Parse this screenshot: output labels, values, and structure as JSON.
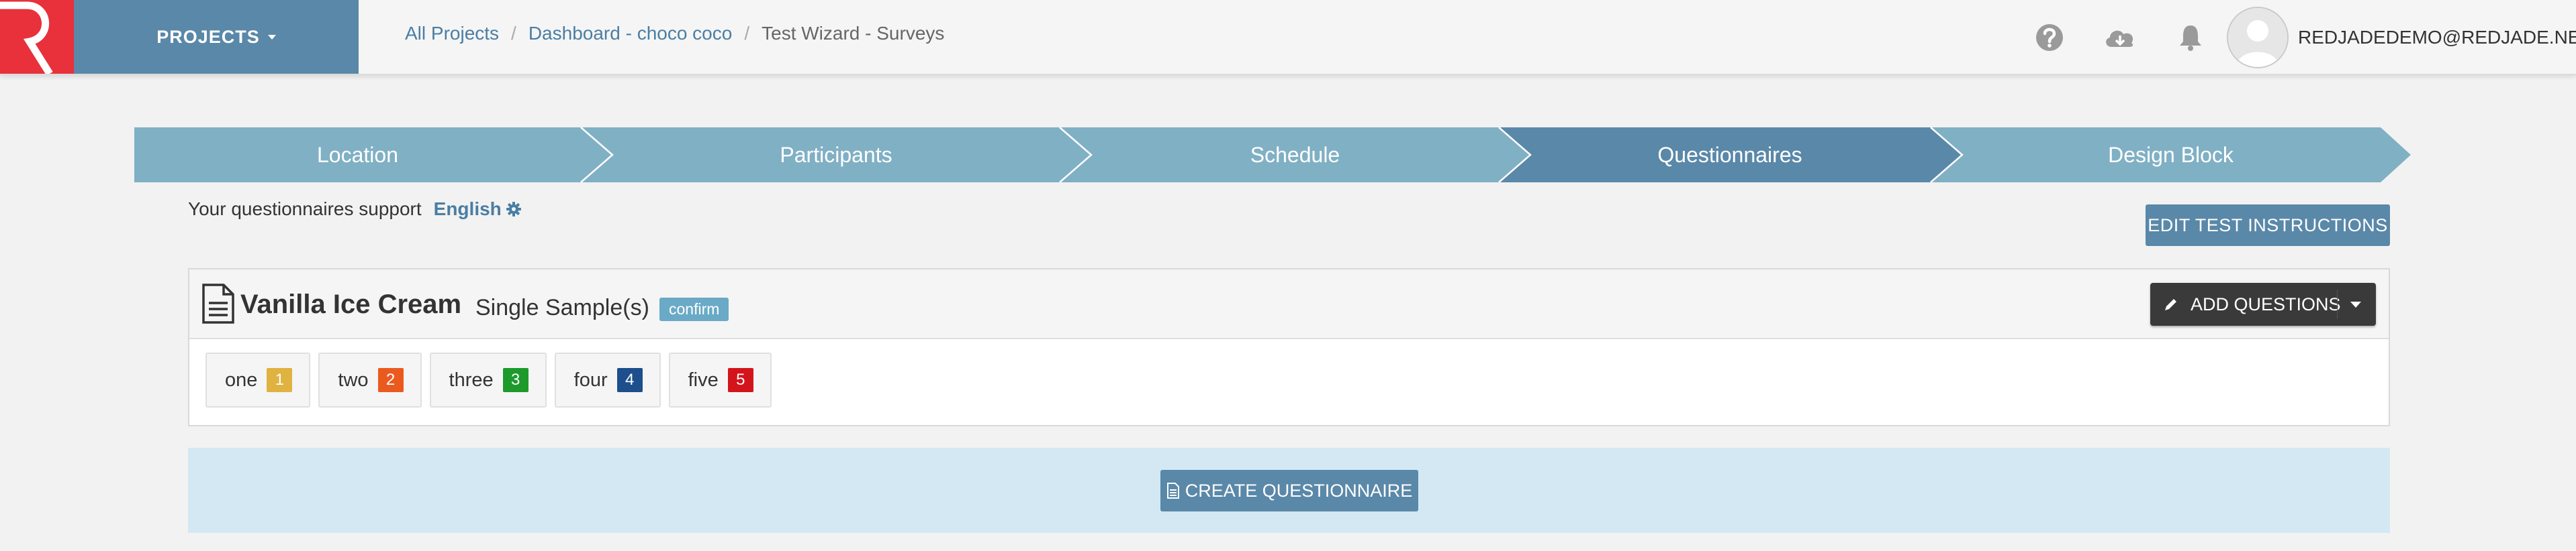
{
  "header": {
    "projects_label": "PROJECTS",
    "breadcrumb": [
      "All Projects",
      "Dashboard - choco coco",
      "Test Wizard - Surveys"
    ],
    "user_email": "REDJADEDEMO@REDJADE.NET",
    "icons": [
      "help-icon",
      "cloud-download-icon",
      "bell-icon",
      "avatar"
    ]
  },
  "wizard": {
    "steps": [
      "Location",
      "Participants",
      "Schedule",
      "Questionnaires",
      "Design Block"
    ],
    "active": "Questionnaires"
  },
  "language": {
    "prefix": "Your questionnaires support",
    "value": "English"
  },
  "toolbar": {
    "edit_instructions": "EDIT TEST INSTRUCTIONS",
    "add_questions": "ADD QUESTIONS",
    "create_questionnaire": "CREATE QUESTIONNAIRE"
  },
  "questionnaire": {
    "title": "Vanilla Ice Cream",
    "type": "Single Sample(s)",
    "badge": "confirm",
    "samples": [
      {
        "label": "one",
        "code": "1",
        "color": "#e0b23f"
      },
      {
        "label": "two",
        "code": "2",
        "color": "#ea5a1f"
      },
      {
        "label": "three",
        "code": "3",
        "color": "#1d9a2b"
      },
      {
        "label": "four",
        "code": "4",
        "color": "#1c4f8c"
      },
      {
        "label": "five",
        "code": "5",
        "color": "#d4141c"
      }
    ]
  },
  "colors": {
    "brand_red": "#e8313b",
    "primary": "#5a88a8",
    "step_inactive": "#80b0c4",
    "step_active": "#5a88a8"
  }
}
